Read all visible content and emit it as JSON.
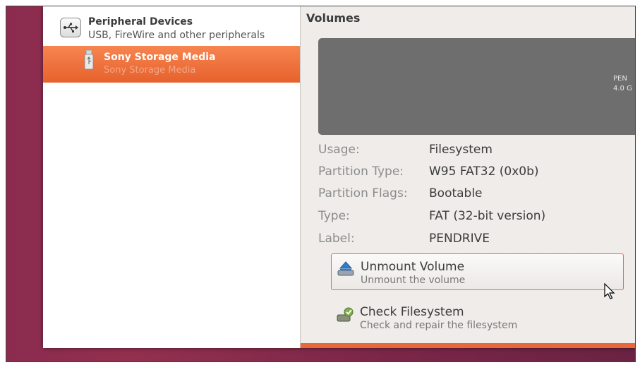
{
  "sidebar": {
    "peripheral": {
      "title": "Peripheral Devices",
      "subtitle": "USB, FireWire and other peripherals",
      "icon": "usb-hub-icon"
    },
    "selected": {
      "title": "Sony Storage Media",
      "subtitle": "Sony Storage Media",
      "icon": "usb-drive-icon"
    }
  },
  "content": {
    "section_title": "Volumes",
    "volume": {
      "name": "PEN",
      "size": "4.0 G"
    },
    "properties": [
      {
        "label": "Usage:",
        "value": "Filesystem"
      },
      {
        "label": "Partition Type:",
        "value": "W95 FAT32 (0x0b)"
      },
      {
        "label": "Partition Flags:",
        "value": "Bootable"
      },
      {
        "label": "Type:",
        "value": "FAT (32-bit version)"
      },
      {
        "label": "Label:",
        "value": "PENDRIVE"
      }
    ],
    "actions": [
      {
        "title": "Unmount Volume",
        "subtitle": "Unmount the volume",
        "icon": "eject-icon"
      },
      {
        "title": "Check Filesystem",
        "subtitle": "Check and repair the filesystem",
        "icon": "check-filesystem-icon"
      }
    ]
  },
  "colors": {
    "accent": "#e6612d",
    "hover_border": "#e36f49",
    "volume_bar": "#6e6e6e"
  }
}
